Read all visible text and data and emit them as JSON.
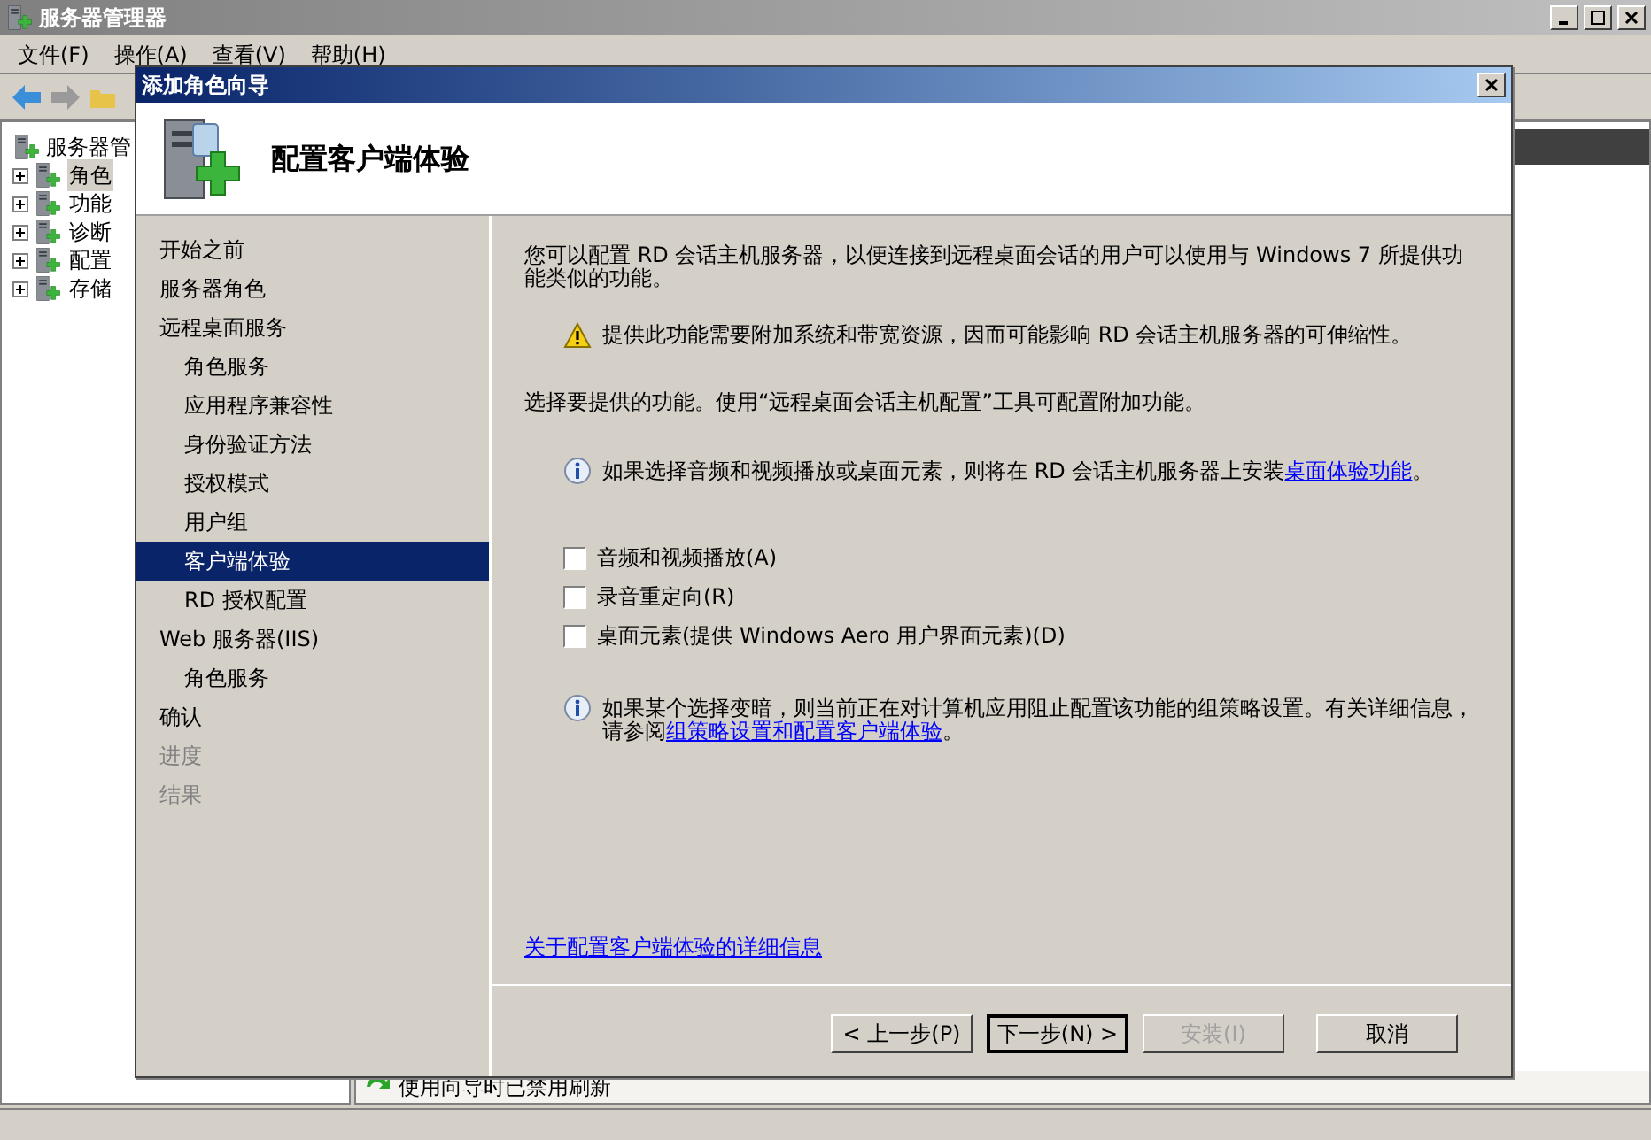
{
  "window": {
    "title": "服务器管理器"
  },
  "menu": [
    "文件(F)",
    "操作(A)",
    "查看(V)",
    "帮助(H)"
  ],
  "tree": [
    {
      "label": "服务器管",
      "expanded": true,
      "selected": false,
      "children": [
        {
          "label": "角色",
          "selected": true
        },
        {
          "label": "功能",
          "selected": false
        },
        {
          "label": "诊断",
          "selected": false
        },
        {
          "label": "配置",
          "selected": false
        },
        {
          "label": "存储",
          "selected": false
        }
      ]
    }
  ],
  "status_text": "使用向导时已禁用刷新",
  "dialog": {
    "title": "添加角色向导",
    "heading": "配置客户端体验",
    "steps": [
      {
        "label": "开始之前",
        "selected": false,
        "disabled": false
      },
      {
        "label": "服务器角色",
        "selected": false,
        "disabled": false
      },
      {
        "label": "远程桌面服务",
        "selected": false,
        "disabled": false,
        "children": [
          {
            "label": "角色服务",
            "selected": false,
            "disabled": false
          },
          {
            "label": "应用程序兼容性",
            "selected": false,
            "disabled": false
          },
          {
            "label": "身份验证方法",
            "selected": false,
            "disabled": false
          },
          {
            "label": "授权模式",
            "selected": false,
            "disabled": false
          },
          {
            "label": "用户组",
            "selected": false,
            "disabled": false
          },
          {
            "label": "客户端体验",
            "selected": true,
            "disabled": false
          },
          {
            "label": "RD 授权配置",
            "selected": false,
            "disabled": false
          }
        ]
      },
      {
        "label": "Web 服务器(IIS)",
        "selected": false,
        "disabled": false,
        "children": [
          {
            "label": "角色服务",
            "selected": false,
            "disabled": false
          }
        ]
      },
      {
        "label": "确认",
        "selected": false,
        "disabled": false
      },
      {
        "label": "进度",
        "selected": false,
        "disabled": true
      },
      {
        "label": "结果",
        "selected": false,
        "disabled": true
      }
    ],
    "intro": "您可以配置 RD 会话主机服务器，以便连接到远程桌面会话的用户可以使用与 Windows 7 所提供功能类似的功能。",
    "warning": "提供此功能需要附加系统和带宽资源，因而可能影响 RD 会话主机服务器的可伸缩性。",
    "select_text": "选择要提供的功能。使用“远程桌面会话主机配置”工具可配置附加功能。",
    "info1": {
      "text": "如果选择音频和视频播放或桌面元素，则将在 RD 会话主机服务器上安装",
      "link": "桌面体验功能",
      "after": "。"
    },
    "options": [
      {
        "label": "音频和视频播放(A)",
        "checked": false
      },
      {
        "label": "录音重定向(R)",
        "checked": false
      },
      {
        "label": "桌面元素(提供 Windows Aero 用户界面元素)(D)",
        "checked": false
      }
    ],
    "info2": {
      "text": "如果某个选择变暗，则当前正在对计算机应用阻止配置该功能的组策略设置。有关详细信息，请参阅",
      "link": "组策略设置和配置客户端体验",
      "after": "。"
    },
    "more_link": "关于配置客户端体验的详细信息",
    "buttons": [
      {
        "label": "< 上一步(P)",
        "disabled": false,
        "default": false
      },
      {
        "label": "下一步(N) >",
        "disabled": false,
        "default": true
      },
      {
        "label": "安装(I)",
        "disabled": true,
        "default": false
      },
      {
        "label": "取消",
        "disabled": false,
        "default": false
      }
    ]
  }
}
